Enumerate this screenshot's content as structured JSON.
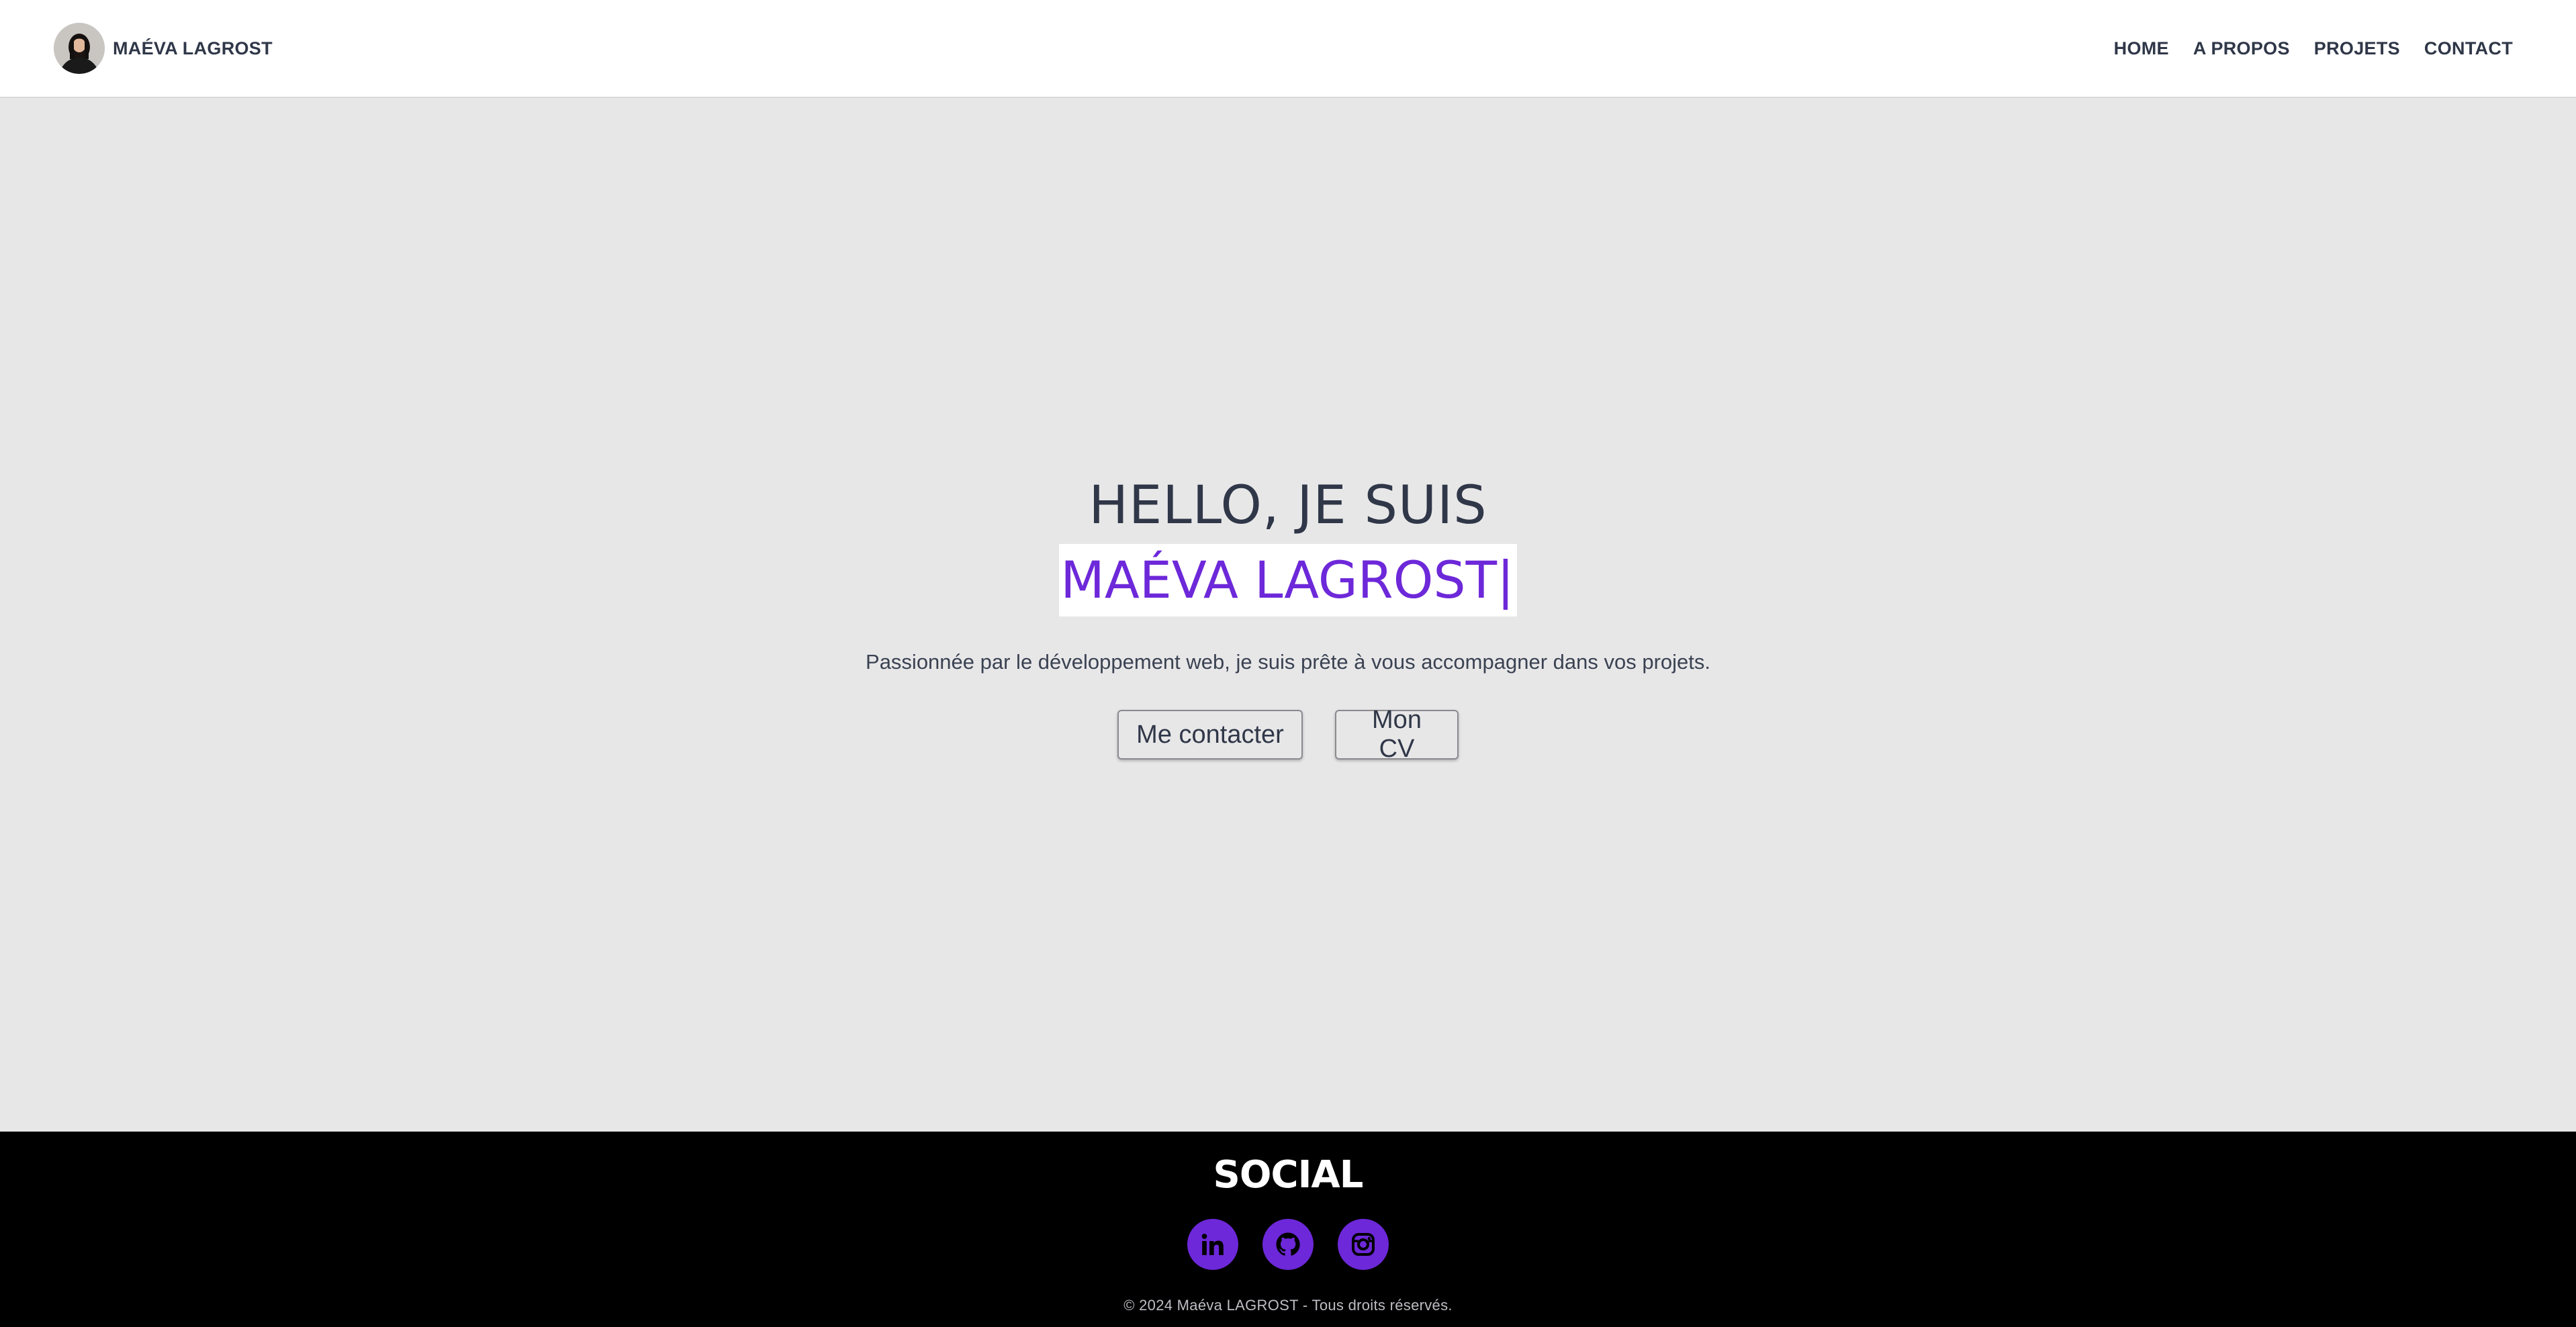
{
  "header": {
    "brand_name": "MAÉVA LAGROST",
    "nav": [
      {
        "label": "HOME"
      },
      {
        "label": "A PROPOS"
      },
      {
        "label": "PROJETS"
      },
      {
        "label": "CONTACT"
      }
    ]
  },
  "hero": {
    "greeting": "HELLO, JE SUIS",
    "name": "MAÉVA LAGROST",
    "cursor": "|",
    "description": "Passionnée par le développement web, je suis prête à vous accompagner dans vos projets.",
    "buttons": {
      "contact_label": "Me contacter",
      "cv_label": "Mon CV"
    }
  },
  "footer": {
    "social_title": "SOCIAL",
    "icons": [
      "linkedin-icon",
      "github-icon",
      "instagram-icon"
    ],
    "copyright": "© 2024 Maéva LAGROST - Tous droits réservés."
  },
  "colors": {
    "accent": "#6d28d9",
    "hero_bg": "#e8e7e8",
    "text": "#2f3748",
    "footer_bg": "#000000"
  }
}
